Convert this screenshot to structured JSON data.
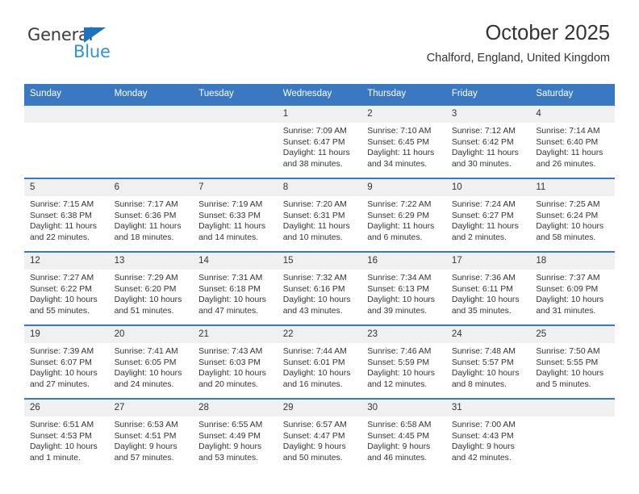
{
  "brand": {
    "name_part1": "General",
    "name_part2": "Blue",
    "logo_accent_color": "#1b74bd",
    "logo_text_color": "#2e93d8"
  },
  "header": {
    "title": "October 2025",
    "subtitle": "Chalford, England, United Kingdom"
  },
  "theme": {
    "header_row_bg": "#3b78c2",
    "daynum_bg": "#f0f0f0",
    "text_color": "#333333"
  },
  "weekday_headers": [
    "Sunday",
    "Monday",
    "Tuesday",
    "Wednesday",
    "Thursday",
    "Friday",
    "Saturday"
  ],
  "weeks": [
    [
      {
        "day": "",
        "sunrise": "",
        "sunset": "",
        "daylight_line1": "",
        "daylight_line2": ""
      },
      {
        "day": "",
        "sunrise": "",
        "sunset": "",
        "daylight_line1": "",
        "daylight_line2": ""
      },
      {
        "day": "",
        "sunrise": "",
        "sunset": "",
        "daylight_line1": "",
        "daylight_line2": ""
      },
      {
        "day": "1",
        "sunrise": "Sunrise: 7:09 AM",
        "sunset": "Sunset: 6:47 PM",
        "daylight_line1": "Daylight: 11 hours",
        "daylight_line2": "and 38 minutes."
      },
      {
        "day": "2",
        "sunrise": "Sunrise: 7:10 AM",
        "sunset": "Sunset: 6:45 PM",
        "daylight_line1": "Daylight: 11 hours",
        "daylight_line2": "and 34 minutes."
      },
      {
        "day": "3",
        "sunrise": "Sunrise: 7:12 AM",
        "sunset": "Sunset: 6:42 PM",
        "daylight_line1": "Daylight: 11 hours",
        "daylight_line2": "and 30 minutes."
      },
      {
        "day": "4",
        "sunrise": "Sunrise: 7:14 AM",
        "sunset": "Sunset: 6:40 PM",
        "daylight_line1": "Daylight: 11 hours",
        "daylight_line2": "and 26 minutes."
      }
    ],
    [
      {
        "day": "5",
        "sunrise": "Sunrise: 7:15 AM",
        "sunset": "Sunset: 6:38 PM",
        "daylight_line1": "Daylight: 11 hours",
        "daylight_line2": "and 22 minutes."
      },
      {
        "day": "6",
        "sunrise": "Sunrise: 7:17 AM",
        "sunset": "Sunset: 6:36 PM",
        "daylight_line1": "Daylight: 11 hours",
        "daylight_line2": "and 18 minutes."
      },
      {
        "day": "7",
        "sunrise": "Sunrise: 7:19 AM",
        "sunset": "Sunset: 6:33 PM",
        "daylight_line1": "Daylight: 11 hours",
        "daylight_line2": "and 14 minutes."
      },
      {
        "day": "8",
        "sunrise": "Sunrise: 7:20 AM",
        "sunset": "Sunset: 6:31 PM",
        "daylight_line1": "Daylight: 11 hours",
        "daylight_line2": "and 10 minutes."
      },
      {
        "day": "9",
        "sunrise": "Sunrise: 7:22 AM",
        "sunset": "Sunset: 6:29 PM",
        "daylight_line1": "Daylight: 11 hours",
        "daylight_line2": "and 6 minutes."
      },
      {
        "day": "10",
        "sunrise": "Sunrise: 7:24 AM",
        "sunset": "Sunset: 6:27 PM",
        "daylight_line1": "Daylight: 11 hours",
        "daylight_line2": "and 2 minutes."
      },
      {
        "day": "11",
        "sunrise": "Sunrise: 7:25 AM",
        "sunset": "Sunset: 6:24 PM",
        "daylight_line1": "Daylight: 10 hours",
        "daylight_line2": "and 58 minutes."
      }
    ],
    [
      {
        "day": "12",
        "sunrise": "Sunrise: 7:27 AM",
        "sunset": "Sunset: 6:22 PM",
        "daylight_line1": "Daylight: 10 hours",
        "daylight_line2": "and 55 minutes."
      },
      {
        "day": "13",
        "sunrise": "Sunrise: 7:29 AM",
        "sunset": "Sunset: 6:20 PM",
        "daylight_line1": "Daylight: 10 hours",
        "daylight_line2": "and 51 minutes."
      },
      {
        "day": "14",
        "sunrise": "Sunrise: 7:31 AM",
        "sunset": "Sunset: 6:18 PM",
        "daylight_line1": "Daylight: 10 hours",
        "daylight_line2": "and 47 minutes."
      },
      {
        "day": "15",
        "sunrise": "Sunrise: 7:32 AM",
        "sunset": "Sunset: 6:16 PM",
        "daylight_line1": "Daylight: 10 hours",
        "daylight_line2": "and 43 minutes."
      },
      {
        "day": "16",
        "sunrise": "Sunrise: 7:34 AM",
        "sunset": "Sunset: 6:13 PM",
        "daylight_line1": "Daylight: 10 hours",
        "daylight_line2": "and 39 minutes."
      },
      {
        "day": "17",
        "sunrise": "Sunrise: 7:36 AM",
        "sunset": "Sunset: 6:11 PM",
        "daylight_line1": "Daylight: 10 hours",
        "daylight_line2": "and 35 minutes."
      },
      {
        "day": "18",
        "sunrise": "Sunrise: 7:37 AM",
        "sunset": "Sunset: 6:09 PM",
        "daylight_line1": "Daylight: 10 hours",
        "daylight_line2": "and 31 minutes."
      }
    ],
    [
      {
        "day": "19",
        "sunrise": "Sunrise: 7:39 AM",
        "sunset": "Sunset: 6:07 PM",
        "daylight_line1": "Daylight: 10 hours",
        "daylight_line2": "and 27 minutes."
      },
      {
        "day": "20",
        "sunrise": "Sunrise: 7:41 AM",
        "sunset": "Sunset: 6:05 PM",
        "daylight_line1": "Daylight: 10 hours",
        "daylight_line2": "and 24 minutes."
      },
      {
        "day": "21",
        "sunrise": "Sunrise: 7:43 AM",
        "sunset": "Sunset: 6:03 PM",
        "daylight_line1": "Daylight: 10 hours",
        "daylight_line2": "and 20 minutes."
      },
      {
        "day": "22",
        "sunrise": "Sunrise: 7:44 AM",
        "sunset": "Sunset: 6:01 PM",
        "daylight_line1": "Daylight: 10 hours",
        "daylight_line2": "and 16 minutes."
      },
      {
        "day": "23",
        "sunrise": "Sunrise: 7:46 AM",
        "sunset": "Sunset: 5:59 PM",
        "daylight_line1": "Daylight: 10 hours",
        "daylight_line2": "and 12 minutes."
      },
      {
        "day": "24",
        "sunrise": "Sunrise: 7:48 AM",
        "sunset": "Sunset: 5:57 PM",
        "daylight_line1": "Daylight: 10 hours",
        "daylight_line2": "and 8 minutes."
      },
      {
        "day": "25",
        "sunrise": "Sunrise: 7:50 AM",
        "sunset": "Sunset: 5:55 PM",
        "daylight_line1": "Daylight: 10 hours",
        "daylight_line2": "and 5 minutes."
      }
    ],
    [
      {
        "day": "26",
        "sunrise": "Sunrise: 6:51 AM",
        "sunset": "Sunset: 4:53 PM",
        "daylight_line1": "Daylight: 10 hours",
        "daylight_line2": "and 1 minute."
      },
      {
        "day": "27",
        "sunrise": "Sunrise: 6:53 AM",
        "sunset": "Sunset: 4:51 PM",
        "daylight_line1": "Daylight: 9 hours",
        "daylight_line2": "and 57 minutes."
      },
      {
        "day": "28",
        "sunrise": "Sunrise: 6:55 AM",
        "sunset": "Sunset: 4:49 PM",
        "daylight_line1": "Daylight: 9 hours",
        "daylight_line2": "and 53 minutes."
      },
      {
        "day": "29",
        "sunrise": "Sunrise: 6:57 AM",
        "sunset": "Sunset: 4:47 PM",
        "daylight_line1": "Daylight: 9 hours",
        "daylight_line2": "and 50 minutes."
      },
      {
        "day": "30",
        "sunrise": "Sunrise: 6:58 AM",
        "sunset": "Sunset: 4:45 PM",
        "daylight_line1": "Daylight: 9 hours",
        "daylight_line2": "and 46 minutes."
      },
      {
        "day": "31",
        "sunrise": "Sunrise: 7:00 AM",
        "sunset": "Sunset: 4:43 PM",
        "daylight_line1": "Daylight: 9 hours",
        "daylight_line2": "and 42 minutes."
      },
      {
        "day": "",
        "sunrise": "",
        "sunset": "",
        "daylight_line1": "",
        "daylight_line2": ""
      }
    ]
  ]
}
